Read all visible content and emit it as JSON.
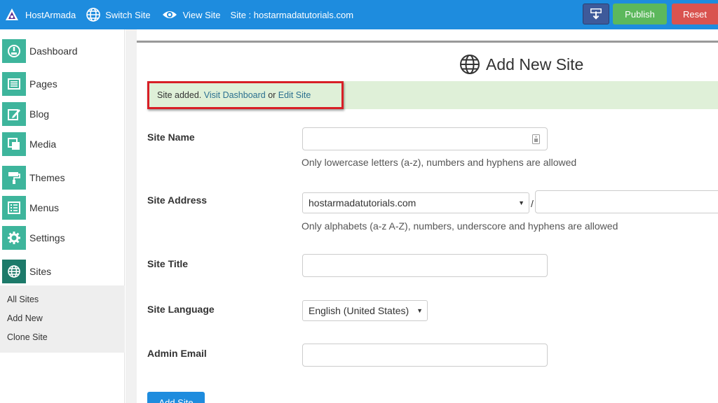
{
  "topbar": {
    "brand": "HostArmada",
    "switch_site": "Switch Site",
    "view_site": "View Site",
    "site_label": "Site : hostarmadatutorials.com",
    "publish": "Publish",
    "reset": "Reset"
  },
  "sidebar": {
    "items": [
      {
        "label": "Dashboard"
      },
      {
        "label": "Pages"
      },
      {
        "label": "Blog"
      },
      {
        "label": "Media"
      },
      {
        "label": "Themes"
      },
      {
        "label": "Menus"
      },
      {
        "label": "Settings"
      },
      {
        "label": "Sites"
      }
    ],
    "submenu": [
      "All Sites",
      "Add New",
      "Clone Site"
    ]
  },
  "main": {
    "title": "Add New Site",
    "notice": {
      "prefix": "Site added. ",
      "link1": "Visit Dashboard",
      "middle": " or ",
      "link2": "Edit Site"
    },
    "form": {
      "site_name_label": "Site Name",
      "site_name_value": "",
      "site_name_help": "Only lowercase letters (a-z), numbers and hyphens are allowed",
      "site_address_label": "Site Address",
      "site_address_domain": "hostarmadatutorials.com",
      "slash": "/",
      "site_address_help": "Only alphabets (a-z A-Z), numbers, underscore and hyphens are allowed",
      "site_title_label": "Site Title",
      "site_language_label": "Site Language",
      "site_language_value": "English (United States)",
      "admin_email_label": "Admin Email",
      "submit": "Add Site"
    }
  },
  "colors": {
    "topbar": "#1e8cde",
    "accent": "#3eb59c",
    "publish": "#5cb85c",
    "reset": "#d9534f",
    "notice_bg": "#dff0d8",
    "highlight": "#d81f26"
  }
}
